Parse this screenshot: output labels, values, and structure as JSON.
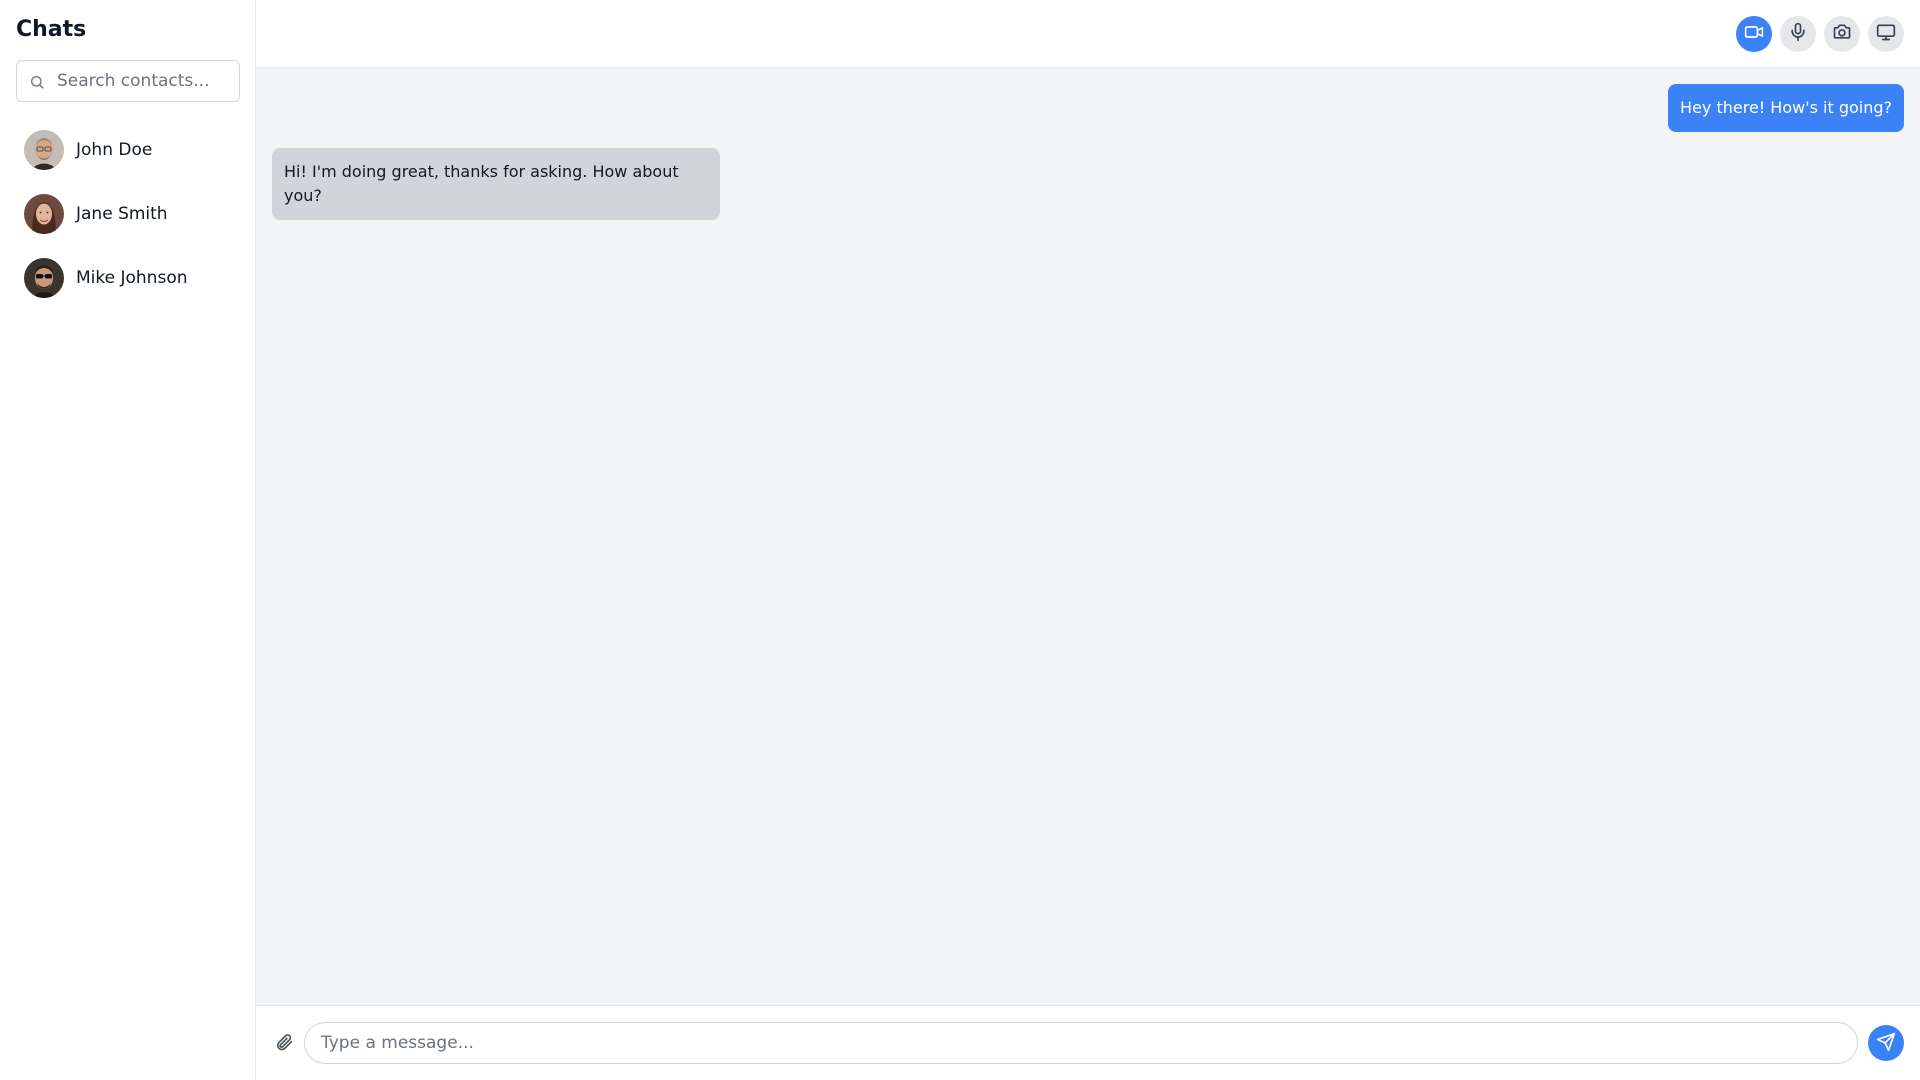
{
  "sidebar": {
    "title": "Chats",
    "search": {
      "placeholder": "Search contacts...",
      "value": "",
      "icon": "search-icon"
    },
    "contacts": [
      {
        "name": "John Doe",
        "avatar": "avatar-john-doe"
      },
      {
        "name": "Jane Smith",
        "avatar": "avatar-jane-smith"
      },
      {
        "name": "Mike Johnson",
        "avatar": "avatar-mike-johnson"
      }
    ]
  },
  "toolbar": {
    "buttons": [
      {
        "icon": "video-camera-icon",
        "active": true
      },
      {
        "icon": "microphone-icon",
        "active": false
      },
      {
        "icon": "camera-icon",
        "active": false
      },
      {
        "icon": "monitor-icon",
        "active": false
      }
    ]
  },
  "messages": [
    {
      "direction": "outgoing",
      "text": "Hey there! How's it going?"
    },
    {
      "direction": "incoming",
      "text": "Hi! I'm doing great, thanks for asking. How about you?"
    }
  ],
  "composer": {
    "placeholder": "Type a message...",
    "value": "",
    "attach_icon": "paperclip-icon",
    "send_icon": "send-icon"
  },
  "colors": {
    "accent": "#3b82f6",
    "chat_background": "#f3f4f6",
    "incoming_bubble": "#d1d5db",
    "tool_button": "#e5e7eb"
  }
}
